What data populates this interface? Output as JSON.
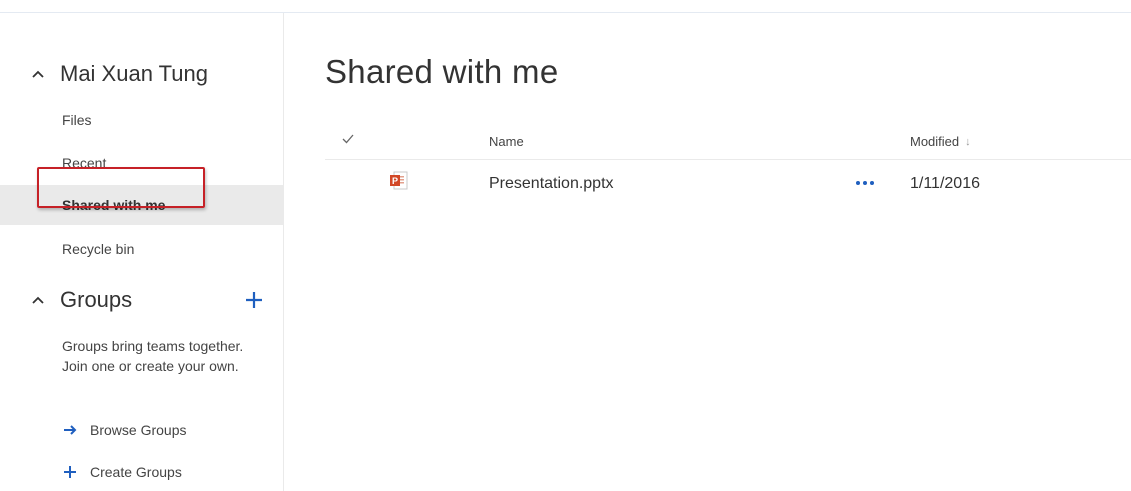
{
  "sidebar": {
    "user_section": {
      "title": "Mai Xuan Tung",
      "items": [
        {
          "label": "Files"
        },
        {
          "label": "Recent"
        },
        {
          "label": "Shared with me",
          "selected": true
        },
        {
          "label": "Recycle bin"
        }
      ]
    },
    "groups_section": {
      "title": "Groups",
      "add_icon": "plus-icon",
      "description": "Groups bring teams together. Join one or create your own.",
      "links": [
        {
          "label": "Browse Groups",
          "icon": "arrow-right-icon"
        },
        {
          "label": "Create Groups",
          "icon": "plus-icon"
        }
      ]
    }
  },
  "main": {
    "title": "Shared with me",
    "columns": {
      "name": "Name",
      "modified": "Modified"
    },
    "files": [
      {
        "name": "Presentation.pptx",
        "modified": "1/11/2016",
        "icon": "powerpoint-file-icon"
      }
    ]
  },
  "colors": {
    "accent": "#1f5fbf",
    "highlight_border": "#c62127",
    "selected_bg": "#eaeaea",
    "ppt_red": "#d24726"
  }
}
